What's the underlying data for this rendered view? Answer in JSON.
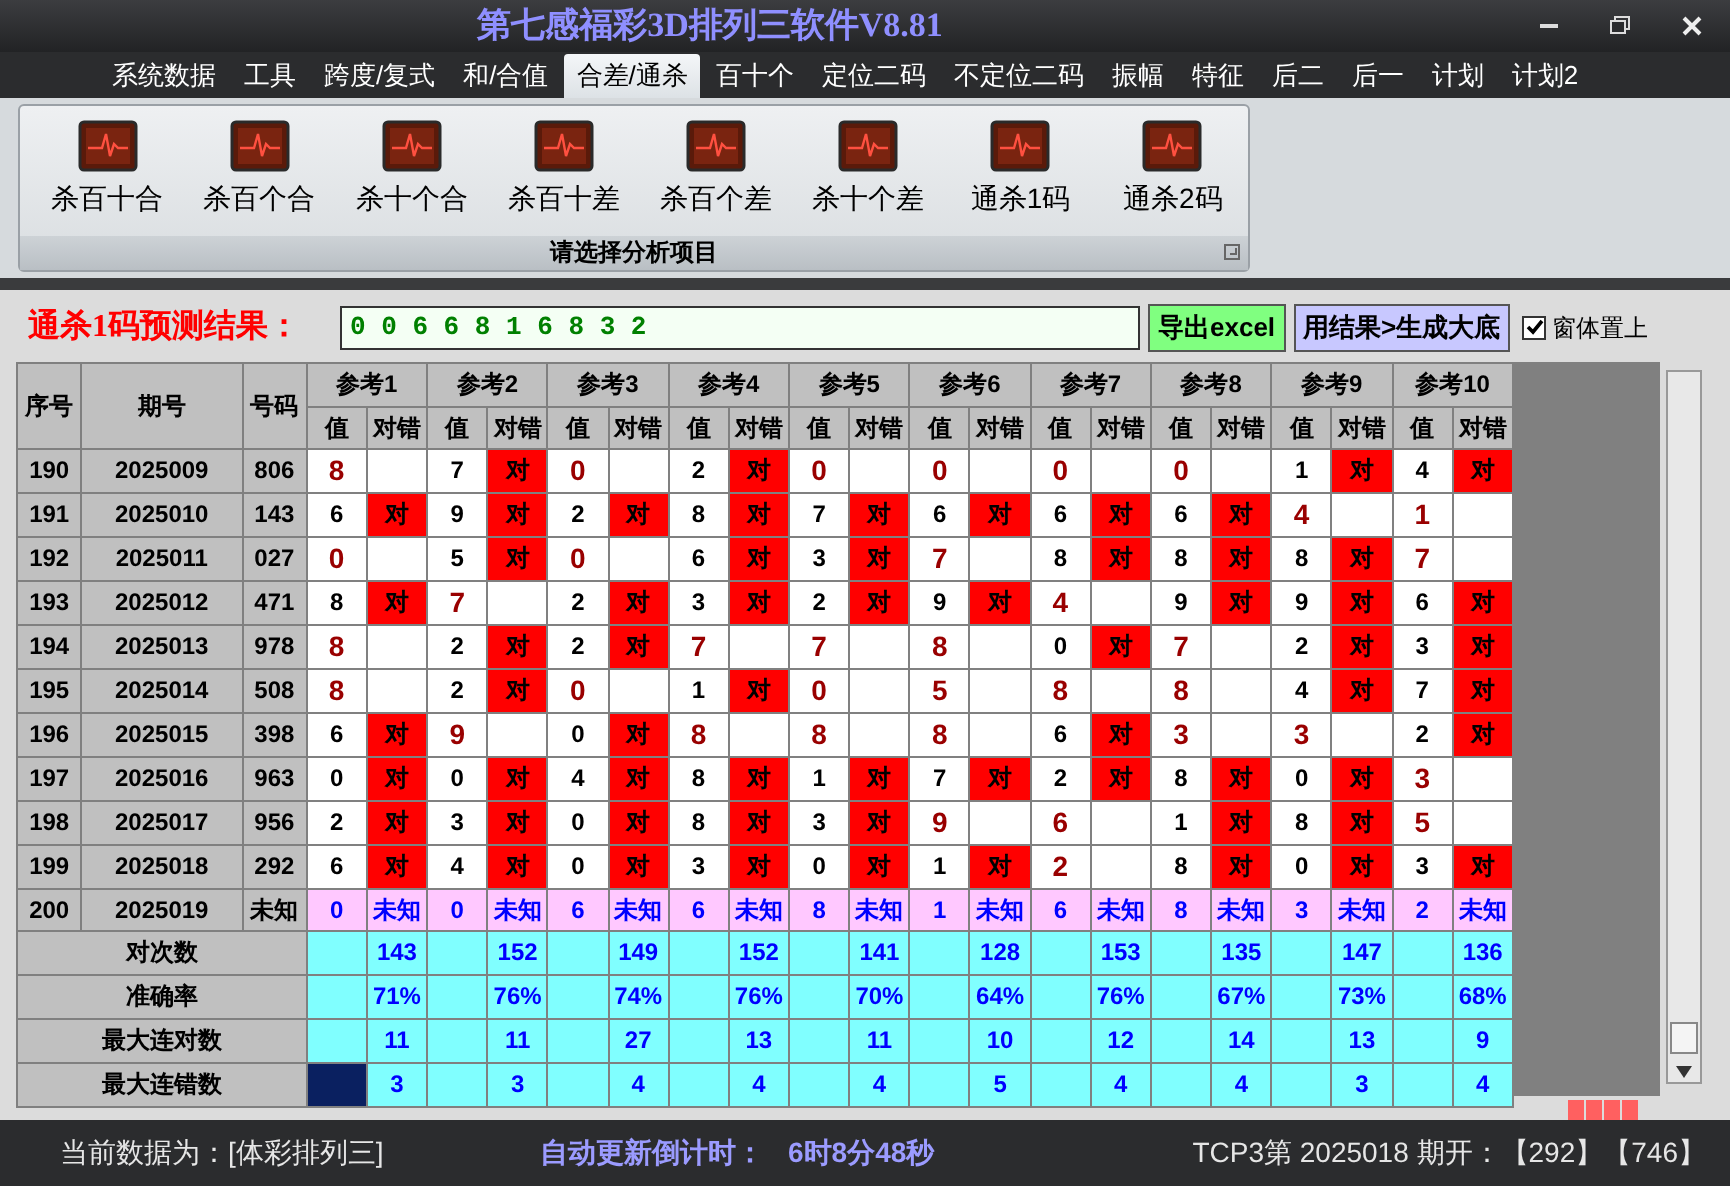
{
  "window": {
    "title": "第七感福彩3D排列三软件V8.81"
  },
  "menu": [
    {
      "label": "系统数据",
      "selected": false
    },
    {
      "label": "工具",
      "selected": false
    },
    {
      "label": "跨度/复式",
      "selected": false
    },
    {
      "label": "和/合值",
      "selected": false
    },
    {
      "label": "合差/通杀",
      "selected": true
    },
    {
      "label": "百十个",
      "selected": false
    },
    {
      "label": "定位二码",
      "selected": false
    },
    {
      "label": "不定位二码",
      "selected": false
    },
    {
      "label": "振幅",
      "selected": false
    },
    {
      "label": "特征",
      "selected": false
    },
    {
      "label": "后二",
      "selected": false
    },
    {
      "label": "后一",
      "selected": false
    },
    {
      "label": "计划",
      "selected": false
    },
    {
      "label": "计划2",
      "selected": false
    }
  ],
  "ribbon": {
    "items": [
      "杀百十合",
      "杀百个合",
      "杀十个合",
      "杀百十差",
      "杀百个差",
      "杀十个差",
      "通杀1码",
      "通杀2码"
    ],
    "group_label": "请选择分析项目"
  },
  "prediction": {
    "label": "通杀1码预测结果：",
    "value": "0 0 6 6 8 1 6 8 3 2",
    "buttons": [
      "导出excel",
      "用结果>生成大底"
    ],
    "topmost": {
      "label": "窗体置上",
      "checked": true
    }
  },
  "table": {
    "columns": {
      "seq": "序号",
      "issue": "期号",
      "number": "号码",
      "ref_labels": [
        "参考1",
        "参考2",
        "参考3",
        "参考4",
        "参考5",
        "参考6",
        "参考7",
        "参考8",
        "参考9",
        "参考10"
      ],
      "sub_headers": [
        {
          "value": "值",
          "result": "对错"
        },
        {
          "value": "值",
          "result": "对错"
        },
        {
          "value": "值",
          "result": "对错"
        },
        {
          "value": "值",
          "result": "对错"
        },
        {
          "value": "值",
          "result": "对错"
        },
        {
          "value": "值",
          "result": "对错"
        },
        {
          "value": "值",
          "result": "对错"
        },
        {
          "value": "值",
          "result": "对错"
        },
        {
          "value": "值",
          "result": "对错"
        },
        {
          "value": "值",
          "result": "对错"
        }
      ]
    },
    "rows": [
      {
        "kind": "done",
        "seq": "190",
        "issue": "2025009",
        "number": "806",
        "refs": [
          {
            "value": "8",
            "hit": false
          },
          {
            "value": "7",
            "hit": true,
            "mark": "对"
          },
          {
            "value": "0",
            "hit": false
          },
          {
            "value": "2",
            "hit": true,
            "mark": "对"
          },
          {
            "value": "0",
            "hit": false
          },
          {
            "value": "0",
            "hit": false
          },
          {
            "value": "0",
            "hit": false
          },
          {
            "value": "0",
            "hit": false
          },
          {
            "value": "1",
            "hit": true,
            "mark": "对"
          },
          {
            "value": "4",
            "hit": true,
            "mark": "对"
          }
        ]
      },
      {
        "kind": "done",
        "seq": "191",
        "issue": "2025010",
        "number": "143",
        "refs": [
          {
            "value": "6",
            "hit": true,
            "mark": "对"
          },
          {
            "value": "9",
            "hit": true,
            "mark": "对"
          },
          {
            "value": "2",
            "hit": true,
            "mark": "对"
          },
          {
            "value": "8",
            "hit": true,
            "mark": "对"
          },
          {
            "value": "7",
            "hit": true,
            "mark": "对"
          },
          {
            "value": "6",
            "hit": true,
            "mark": "对"
          },
          {
            "value": "6",
            "hit": true,
            "mark": "对"
          },
          {
            "value": "6",
            "hit": true,
            "mark": "对"
          },
          {
            "value": "4",
            "hit": false
          },
          {
            "value": "1",
            "hit": false
          }
        ]
      },
      {
        "kind": "done",
        "seq": "192",
        "issue": "2025011",
        "number": "027",
        "refs": [
          {
            "value": "0",
            "hit": false
          },
          {
            "value": "5",
            "hit": true,
            "mark": "对"
          },
          {
            "value": "0",
            "hit": false
          },
          {
            "value": "6",
            "hit": true,
            "mark": "对"
          },
          {
            "value": "3",
            "hit": true,
            "mark": "对"
          },
          {
            "value": "7",
            "hit": false
          },
          {
            "value": "8",
            "hit": true,
            "mark": "对"
          },
          {
            "value": "8",
            "hit": true,
            "mark": "对"
          },
          {
            "value": "8",
            "hit": true,
            "mark": "对"
          },
          {
            "value": "7",
            "hit": false
          }
        ]
      },
      {
        "kind": "done",
        "seq": "193",
        "issue": "2025012",
        "number": "471",
        "refs": [
          {
            "value": "8",
            "hit": true,
            "mark": "对"
          },
          {
            "value": "7",
            "hit": false
          },
          {
            "value": "2",
            "hit": true,
            "mark": "对"
          },
          {
            "value": "3",
            "hit": true,
            "mark": "对"
          },
          {
            "value": "2",
            "hit": true,
            "mark": "对"
          },
          {
            "value": "9",
            "hit": true,
            "mark": "对"
          },
          {
            "value": "4",
            "hit": false
          },
          {
            "value": "9",
            "hit": true,
            "mark": "对"
          },
          {
            "value": "9",
            "hit": true,
            "mark": "对"
          },
          {
            "value": "6",
            "hit": true,
            "mark": "对"
          }
        ]
      },
      {
        "kind": "done",
        "seq": "194",
        "issue": "2025013",
        "number": "978",
        "refs": [
          {
            "value": "8",
            "hit": false
          },
          {
            "value": "2",
            "hit": true,
            "mark": "对"
          },
          {
            "value": "2",
            "hit": true,
            "mark": "对"
          },
          {
            "value": "7",
            "hit": false
          },
          {
            "value": "7",
            "hit": false
          },
          {
            "value": "8",
            "hit": false
          },
          {
            "value": "0",
            "hit": true,
            "mark": "对"
          },
          {
            "value": "7",
            "hit": false
          },
          {
            "value": "2",
            "hit": true,
            "mark": "对"
          },
          {
            "value": "3",
            "hit": true,
            "mark": "对"
          }
        ]
      },
      {
        "kind": "done",
        "seq": "195",
        "issue": "2025014",
        "number": "508",
        "refs": [
          {
            "value": "8",
            "hit": false
          },
          {
            "value": "2",
            "hit": true,
            "mark": "对"
          },
          {
            "value": "0",
            "hit": false
          },
          {
            "value": "1",
            "hit": true,
            "mark": "对"
          },
          {
            "value": "0",
            "hit": false
          },
          {
            "value": "5",
            "hit": false
          },
          {
            "value": "8",
            "hit": false
          },
          {
            "value": "8",
            "hit": false
          },
          {
            "value": "4",
            "hit": true,
            "mark": "对"
          },
          {
            "value": "7",
            "hit": true,
            "mark": "对"
          }
        ]
      },
      {
        "kind": "done",
        "seq": "196",
        "issue": "2025015",
        "number": "398",
        "refs": [
          {
            "value": "6",
            "hit": true,
            "mark": "对"
          },
          {
            "value": "9",
            "hit": false
          },
          {
            "value": "0",
            "hit": true,
            "mark": "对"
          },
          {
            "value": "8",
            "hit": false
          },
          {
            "value": "8",
            "hit": false
          },
          {
            "value": "8",
            "hit": false
          },
          {
            "value": "6",
            "hit": true,
            "mark": "对"
          },
          {
            "value": "3",
            "hit": false
          },
          {
            "value": "3",
            "hit": false
          },
          {
            "value": "2",
            "hit": true,
            "mark": "对"
          }
        ]
      },
      {
        "kind": "done",
        "seq": "197",
        "issue": "2025016",
        "number": "963",
        "refs": [
          {
            "value": "0",
            "hit": true,
            "mark": "对"
          },
          {
            "value": "0",
            "hit": true,
            "mark": "对"
          },
          {
            "value": "4",
            "hit": true,
            "mark": "对"
          },
          {
            "value": "8",
            "hit": true,
            "mark": "对"
          },
          {
            "value": "1",
            "hit": true,
            "mark": "对"
          },
          {
            "value": "7",
            "hit": true,
            "mark": "对"
          },
          {
            "value": "2",
            "hit": true,
            "mark": "对"
          },
          {
            "value": "8",
            "hit": true,
            "mark": "对"
          },
          {
            "value": "0",
            "hit": true,
            "mark": "对"
          },
          {
            "value": "3",
            "hit": false
          }
        ]
      },
      {
        "kind": "done",
        "seq": "198",
        "issue": "2025017",
        "number": "956",
        "refs": [
          {
            "value": "2",
            "hit": true,
            "mark": "对"
          },
          {
            "value": "3",
            "hit": true,
            "mark": "对"
          },
          {
            "value": "0",
            "hit": true,
            "mark": "对"
          },
          {
            "value": "8",
            "hit": true,
            "mark": "对"
          },
          {
            "value": "3",
            "hit": true,
            "mark": "对"
          },
          {
            "value": "9",
            "hit": false
          },
          {
            "value": "6",
            "hit": false
          },
          {
            "value": "1",
            "hit": true,
            "mark": "对"
          },
          {
            "value": "8",
            "hit": true,
            "mark": "对"
          },
          {
            "value": "5",
            "hit": false
          }
        ]
      },
      {
        "kind": "done",
        "seq": "199",
        "issue": "2025018",
        "number": "292",
        "refs": [
          {
            "value": "6",
            "hit": true,
            "mark": "对"
          },
          {
            "value": "4",
            "hit": true,
            "mark": "对"
          },
          {
            "value": "0",
            "hit": true,
            "mark": "对"
          },
          {
            "value": "3",
            "hit": true,
            "mark": "对"
          },
          {
            "value": "0",
            "hit": true,
            "mark": "对"
          },
          {
            "value": "1",
            "hit": true,
            "mark": "对"
          },
          {
            "value": "2",
            "hit": false
          },
          {
            "value": "8",
            "hit": true,
            "mark": "对"
          },
          {
            "value": "0",
            "hit": true,
            "mark": "对"
          },
          {
            "value": "3",
            "hit": true,
            "mark": "对"
          }
        ]
      },
      {
        "kind": "pending",
        "seq": "200",
        "issue": "2025019",
        "number": "未知",
        "refs": [
          {
            "value": "0",
            "mark": "未知"
          },
          {
            "value": "0",
            "mark": "未知"
          },
          {
            "value": "6",
            "mark": "未知"
          },
          {
            "value": "6",
            "mark": "未知"
          },
          {
            "value": "8",
            "mark": "未知"
          },
          {
            "value": "1",
            "mark": "未知"
          },
          {
            "value": "6",
            "mark": "未知"
          },
          {
            "value": "8",
            "mark": "未知"
          },
          {
            "value": "3",
            "mark": "未知"
          },
          {
            "value": "2",
            "mark": "未知"
          }
        ]
      }
    ],
    "stats": [
      {
        "label": "对次数",
        "cursor": false,
        "values": [
          "143",
          "152",
          "149",
          "152",
          "141",
          "128",
          "153",
          "135",
          "147",
          "136"
        ]
      },
      {
        "label": "准确率",
        "cursor": false,
        "values": [
          "71%",
          "76%",
          "74%",
          "76%",
          "70%",
          "64%",
          "76%",
          "67%",
          "73%",
          "68%"
        ]
      },
      {
        "label": "最大连对数",
        "cursor": false,
        "values": [
          "11",
          "11",
          "27",
          "13",
          "11",
          "10",
          "12",
          "14",
          "13",
          "9"
        ]
      },
      {
        "label": "最大连错数",
        "cursor": true,
        "values": [
          "3",
          "3",
          "4",
          "4",
          "4",
          "5",
          "4",
          "4",
          "3",
          "4"
        ]
      }
    ]
  },
  "status_bar": {
    "data_label": "当前数据为：[体彩排列三]",
    "countdown_label": "自动更新倒计时：",
    "countdown": "6时8分48秒",
    "draw_info": "TCP3第 2025018 期开：【292】【746】"
  }
}
